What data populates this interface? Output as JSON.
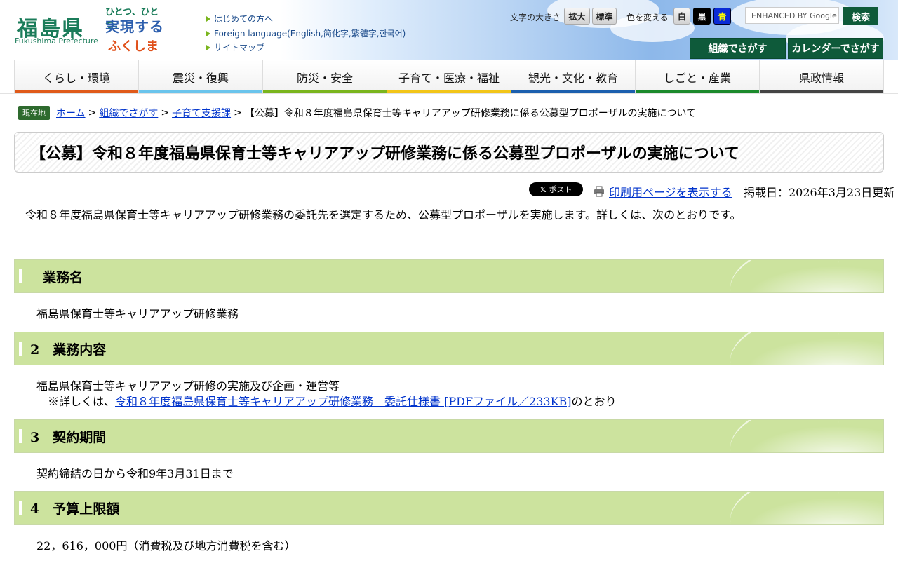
{
  "header": {
    "logo_kanji": "福島県",
    "logo_en": "Fukushima Prefecture",
    "slogan_lines": [
      "ひとつ、ひとつ、",
      "実現する",
      "ふくしま"
    ],
    "top_links": [
      "はじめての方へ",
      "Foreign language(English,简化字,繁體字,한국어)",
      "サイトマップ"
    ],
    "font_size_label": "文字の大きさ",
    "font_size_large": "拡大",
    "font_size_normal": "標準",
    "color_label": "色を変える",
    "color_white": "白",
    "color_black": "黒",
    "color_blue": "青",
    "search_placeholder": "ENHANCED BY Google",
    "search_button": "検索",
    "org_search": "組織でさがす",
    "calendar_search": "カレンダーでさがす"
  },
  "gnav": [
    {
      "label": "くらし・環境",
      "color": "#e05a1a"
    },
    {
      "label": "震災・復興",
      "color": "#6ac4ec"
    },
    {
      "label": "防災・安全",
      "color": "#7ab51d"
    },
    {
      "label": "子育て・医療・福祉",
      "color": "#f2c518"
    },
    {
      "label": "観光・文化・教育",
      "color": "#1c5fae"
    },
    {
      "label": "しごと・産業",
      "color": "#1b8a2c"
    },
    {
      "label": "県政情報",
      "color": "#444444"
    }
  ],
  "breadcrumb": {
    "badge": "現在地",
    "items": [
      "ホーム",
      "組織でさがす",
      "子育て支援課"
    ],
    "current": "【公募】令和８年度福島県保育士等キャリアアップ研修業務に係る公募型プロポーザルの実施について",
    "sep": ">"
  },
  "page": {
    "title": "【公募】令和８年度福島県保育士等キャリアアップ研修業務に係る公募型プロポーザルの実施について",
    "post_button": "ポスト",
    "print_link": "印刷用ページを表示する",
    "updated": "掲載日：2026年3月23日更新",
    "intro": "令和８年度福島県保育士等キャリアアップ研修業務の委託先を選定するため、公募型プロポーザルを実施します。詳しくは、次のとおりです。"
  },
  "sections": [
    {
      "heading": "業務名",
      "body": "福島県保育士等キャリアアップ研修業務"
    },
    {
      "heading": "2　業務内容",
      "body": "福島県保育士等キャリアアップ研修の実施及び企画・運営等",
      "note_prefix": "※詳しくは、",
      "note_link": "令和８年度福島県保育士等キャリアアップ研修業務　委託仕様書 [PDFファイル／233KB]",
      "note_suffix": "のとおり"
    },
    {
      "heading": "3　契約期間",
      "body": "契約締結の日から令和9年3月31日まで"
    },
    {
      "heading": "4　予算上限額",
      "body": "22，616，000円（消費税及び地方消費税を含む）"
    }
  ]
}
